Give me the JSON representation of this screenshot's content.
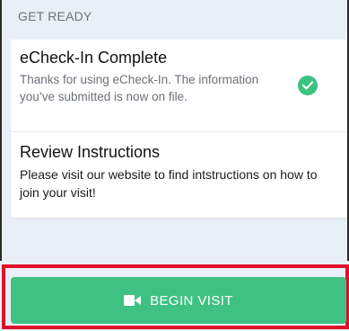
{
  "section": {
    "header": "GET READY"
  },
  "checkin_card": {
    "title": "eCheck-In Complete",
    "body": "Thanks for using eCheck-In. The information you’ve submitted is now on file.",
    "status_icon": "check-circle-icon",
    "status_color": "#3ac381"
  },
  "review_card": {
    "title": "Review Instructions",
    "body": "Please visit our website to find intstructions on how to join your visit!"
  },
  "begin_button": {
    "label": "BEGIN VISIT",
    "icon": "video-camera-icon",
    "color": "#3fc281"
  },
  "highlight": {
    "color": "#e0112a"
  }
}
